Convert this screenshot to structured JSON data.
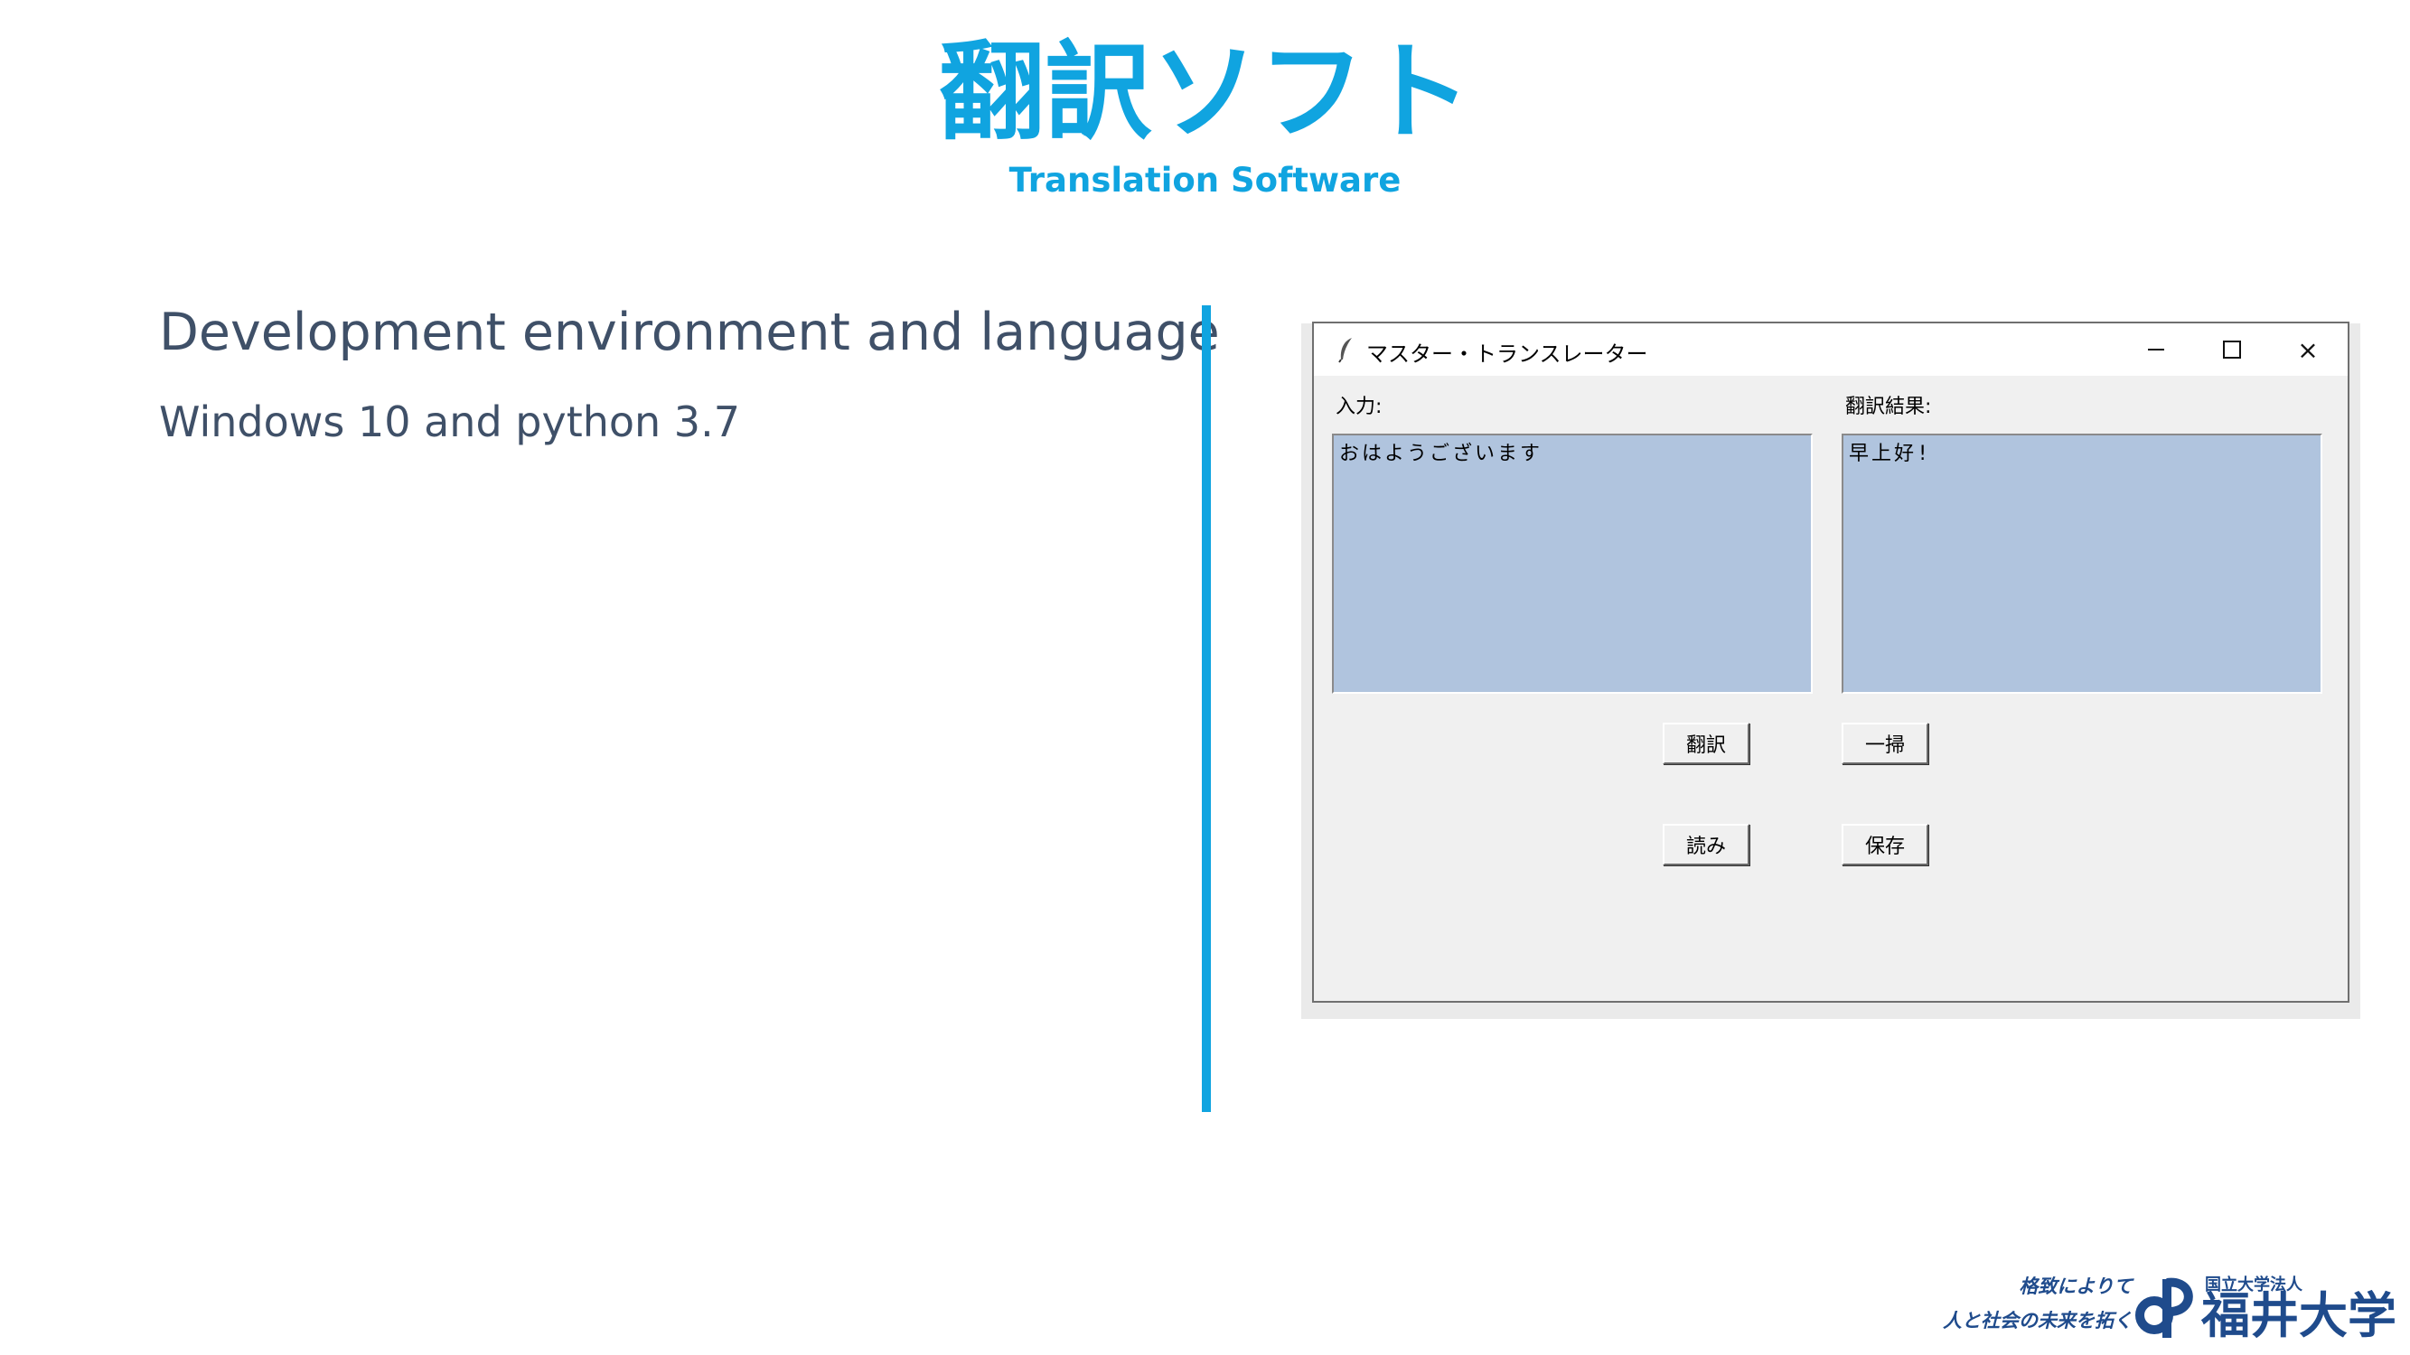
{
  "slide": {
    "title": "翻訳ソフト",
    "subtitle": "Translation Software",
    "heading": "Development environment and language",
    "subtext": "Windows 10 and python 3.7"
  },
  "window": {
    "title": "マスター・トランスレーター",
    "icon": "feather-icon",
    "controls": {
      "minimize": "minimize-icon",
      "maximize": "maximize-icon",
      "close": "×"
    },
    "input_label": "入力:",
    "output_label": "翻訳結果:",
    "input_text": "おはようございます",
    "output_text": "早上好!",
    "textbox_color": "#b0c4de",
    "buttons": {
      "translate": "翻訳",
      "clear": "一掃",
      "load": "読み",
      "save": "保存"
    }
  },
  "logo": {
    "motto_line1": "格致によりて",
    "motto_line2": "人と社会の未来を拓く",
    "small_text": "国立大学法人",
    "name": "福井大学",
    "color": "#1f4b8c"
  },
  "accent_color": "#10a4e0"
}
